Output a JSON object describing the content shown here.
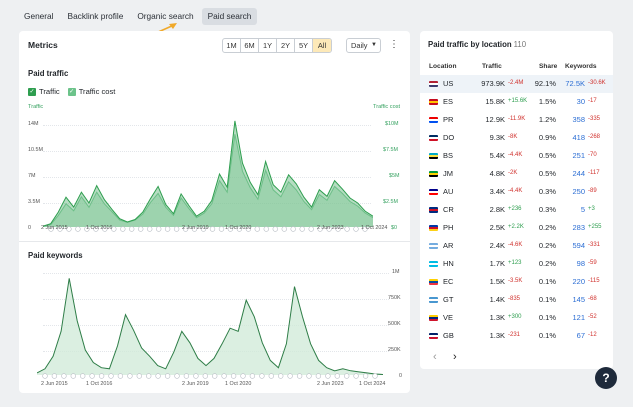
{
  "tabs": [
    {
      "label": "General"
    },
    {
      "label": "Backlink profile"
    },
    {
      "label": "Organic search"
    },
    {
      "label": "Paid search",
      "active": true
    }
  ],
  "metrics": {
    "title": "Metrics",
    "ranges": [
      "1M",
      "6M",
      "1Y",
      "2Y",
      "5Y",
      "All"
    ],
    "active_range": "All",
    "granularity": "Daily",
    "more_icon": "kebab-icon"
  },
  "paid_traffic": {
    "title": "Paid traffic",
    "legend": [
      {
        "label": "Traffic",
        "color": "#2e9e4f",
        "checked": true
      },
      {
        "label": "Traffic cost",
        "color": "#6cc38a",
        "checked": true
      }
    ],
    "left_axis_label": "Traffic",
    "right_axis_label": "Traffic cost",
    "left_ticks": [
      "14M",
      "10.5M",
      "7M",
      "3.5M",
      "0"
    ],
    "right_ticks": [
      "$10M",
      "$7.5M",
      "$5M",
      "$2.5M",
      "$0"
    ],
    "x_ticks": [
      "2 Jun 2015",
      "1 Oct 2016",
      "2 Jun 2019",
      "1 Oct 2020",
      "2 Jun 2023",
      "1 Oct 2024"
    ]
  },
  "paid_keywords": {
    "title": "Paid keywords",
    "right_ticks": [
      "1M",
      "750K",
      "500K",
      "250K",
      "0"
    ],
    "x_ticks": [
      "2 Jun 2015",
      "1 Oct 2016",
      "2 Jun 2019",
      "1 Oct 2020",
      "2 Jun 2023",
      "1 Oct 2024"
    ]
  },
  "chart_data": [
    {
      "type": "area",
      "title": "Paid traffic",
      "x": [
        "2015-06-02",
        "2024-10-01"
      ],
      "ylim": [
        0,
        14000000
      ],
      "ylim_right": [
        0,
        10000000
      ],
      "series": [
        {
          "name": "Traffic",
          "values": [
            0.1,
            0.4,
            1.8,
            3.6,
            2.4,
            4.2,
            2.9,
            5.0,
            3.3,
            2.1,
            1.0,
            0.6,
            0.9,
            1.8,
            3.4,
            4.9,
            2.7,
            1.6,
            4.0,
            2.6,
            1.3,
            1.9,
            3.2,
            6.4,
            4.8,
            12.8,
            7.7,
            5.4,
            3.9,
            7.9,
            5.1,
            4.2,
            6.3,
            5.2,
            3.6,
            2.4,
            4.5,
            3.7,
            5.6,
            4.6,
            3.5,
            2.9,
            1.9,
            1.3
          ]
        },
        {
          "name": "Traffic cost",
          "values": [
            0.05,
            0.2,
            1.0,
            2.0,
            1.4,
            2.6,
            1.7,
            3.0,
            2.0,
            1.3,
            0.6,
            0.4,
            0.6,
            1.1,
            2.1,
            2.9,
            1.7,
            1.0,
            2.5,
            1.6,
            0.8,
            1.2,
            2.0,
            4.0,
            3.0,
            8.0,
            4.8,
            3.4,
            2.4,
            4.9,
            3.2,
            2.6,
            3.9,
            3.2,
            2.2,
            1.5,
            2.8,
            2.3,
            3.5,
            2.9,
            2.2,
            1.8,
            1.2,
            0.8
          ]
        }
      ]
    },
    {
      "type": "area",
      "title": "Paid keywords",
      "x": [
        "2015-06-02",
        "2024-10-01"
      ],
      "ylim": [
        0,
        1000000
      ],
      "series": [
        {
          "name": "Paid keywords",
          "values": [
            20000,
            60000,
            180000,
            420000,
            930000,
            520000,
            240000,
            120000,
            70000,
            60000,
            280000,
            580000,
            430000,
            260000,
            180000,
            90000,
            60000,
            220000,
            420000,
            310000,
            160000,
            90000,
            160000,
            300000,
            450000,
            420000,
            720000,
            560000,
            310000,
            140000,
            70000,
            300000,
            850000,
            560000,
            300000,
            140000,
            70000,
            40000,
            60000,
            40000,
            30000,
            20000,
            10000,
            5000
          ]
        }
      ]
    }
  ],
  "location_panel": {
    "title": "Paid traffic by location",
    "count": "110",
    "headers": {
      "location": "Location",
      "traffic": "Traffic",
      "share": "Share",
      "keywords": "Keywords"
    },
    "rows": [
      {
        "code": "US",
        "traffic": "973.9K",
        "delta": "-2.4M",
        "share": "92.1%",
        "keywords": "72.5K",
        "kw_delta": "-30.6K",
        "flag": [
          "#b22234",
          "#ffffff",
          "#3c3b6e"
        ]
      },
      {
        "code": "ES",
        "traffic": "15.8K",
        "delta": "+15.6K",
        "share": "1.5%",
        "keywords": "30",
        "kw_delta": "-17",
        "flag": [
          "#c60b1e",
          "#ffc400",
          "#c60b1e"
        ]
      },
      {
        "code": "PR",
        "traffic": "12.9K",
        "delta": "-11.9K",
        "share": "1.2%",
        "keywords": "358",
        "kw_delta": "-335",
        "flag": [
          "#ed0000",
          "#ffffff",
          "#0050f0"
        ]
      },
      {
        "code": "DO",
        "traffic": "9.3K",
        "delta": "-8K",
        "share": "0.9%",
        "keywords": "418",
        "kw_delta": "-268",
        "flag": [
          "#002d62",
          "#ffffff",
          "#ce1126"
        ]
      },
      {
        "code": "BS",
        "traffic": "5.4K",
        "delta": "-4.4K",
        "share": "0.5%",
        "keywords": "251",
        "kw_delta": "-70",
        "flag": [
          "#00abc9",
          "#fae042",
          "#000000"
        ]
      },
      {
        "code": "JM",
        "traffic": "4.8K",
        "delta": "-2K",
        "share": "0.5%",
        "keywords": "244",
        "kw_delta": "-117",
        "flag": [
          "#009b3a",
          "#fed100",
          "#000000"
        ]
      },
      {
        "code": "AU",
        "traffic": "3.4K",
        "delta": "-4.4K",
        "share": "0.3%",
        "keywords": "250",
        "kw_delta": "-89",
        "flag": [
          "#00008b",
          "#ffffff",
          "#ff0000"
        ]
      },
      {
        "code": "CR",
        "traffic": "2.8K",
        "delta": "+236",
        "share": "0.3%",
        "keywords": "5",
        "kw_delta": "+3",
        "flag": [
          "#002b7f",
          "#ce1126",
          "#002b7f"
        ]
      },
      {
        "code": "PH",
        "traffic": "2.5K",
        "delta": "+2.2K",
        "share": "0.2%",
        "keywords": "283",
        "kw_delta": "+255",
        "flag": [
          "#0038a8",
          "#ce1126",
          "#fcd116"
        ]
      },
      {
        "code": "AR",
        "traffic": "2.4K",
        "delta": "-4.6K",
        "share": "0.2%",
        "keywords": "594",
        "kw_delta": "-331",
        "flag": [
          "#74acdf",
          "#ffffff",
          "#74acdf"
        ]
      },
      {
        "code": "HN",
        "traffic": "1.7K",
        "delta": "+123",
        "share": "0.2%",
        "keywords": "98",
        "kw_delta": "-59",
        "flag": [
          "#00bce4",
          "#ffffff",
          "#00bce4"
        ]
      },
      {
        "code": "EC",
        "traffic": "1.5K",
        "delta": "-3.5K",
        "share": "0.1%",
        "keywords": "220",
        "kw_delta": "-115",
        "flag": [
          "#ffd100",
          "#034ea2",
          "#ef3340"
        ]
      },
      {
        "code": "GT",
        "traffic": "1.4K",
        "delta": "-835",
        "share": "0.1%",
        "keywords": "145",
        "kw_delta": "-68",
        "flag": [
          "#4997d0",
          "#ffffff",
          "#4997d0"
        ]
      },
      {
        "code": "VE",
        "traffic": "1.3K",
        "delta": "+300",
        "share": "0.1%",
        "keywords": "121",
        "kw_delta": "-52",
        "flag": [
          "#ffcc00",
          "#00247d",
          "#cf142b"
        ]
      },
      {
        "code": "GB",
        "traffic": "1.3K",
        "delta": "-231",
        "share": "0.1%",
        "keywords": "67",
        "kw_delta": "-12",
        "flag": [
          "#012169",
          "#ffffff",
          "#c8102e"
        ]
      }
    ],
    "pager": {
      "prev": "‹",
      "next": "›"
    }
  },
  "help": {
    "label": "?"
  }
}
